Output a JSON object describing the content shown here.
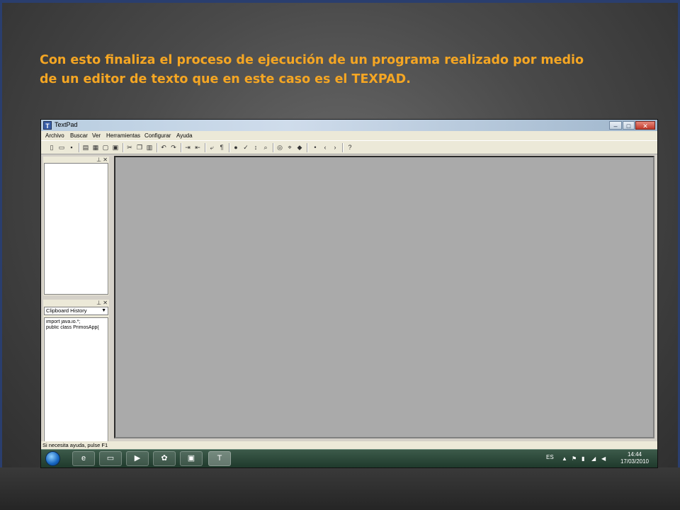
{
  "caption": {
    "line1": "Con esto finaliza el proceso de ejecución de un programa realizado por medio",
    "line2": "de un editor de texto que en este caso es el TEXPAD."
  },
  "window": {
    "title": "TextPad",
    "icon_label": "T",
    "controls": [
      "minimize-icon",
      "maximize-icon",
      "close-icon"
    ]
  },
  "menu": [
    "Archivo",
    "Buscar",
    "Ver",
    "Herramientas",
    "Configurar",
    "Ayuda"
  ],
  "toolbar_icons": [
    "new-file-icon",
    "open-folder-icon",
    "save-icon",
    "print-icon",
    "print-preview-icon",
    "spellcheck-icon",
    "cut-icon",
    "copy-icon",
    "paste-icon",
    "undo-icon",
    "redo-icon",
    "indent-icon",
    "outdent-icon",
    "word-wrap-icon",
    "paragraph-icon",
    "record-macro-icon",
    "spell-icon",
    "sort-icon",
    "find-icon",
    "find-next-icon",
    "replace-icon",
    "tool-icon",
    "bullet-icon",
    "prev-icon",
    "next-icon",
    "help-icon"
  ],
  "clipboard": {
    "selected": "Clipboard History",
    "items": [
      "import java.io.*;",
      "public class PrimosApp{"
    ]
  },
  "status": {
    "text": "Si necesita ayuda, pulse F1"
  },
  "taskbar": {
    "language": "ES",
    "time": "14:44",
    "date": "17/03/2010"
  }
}
